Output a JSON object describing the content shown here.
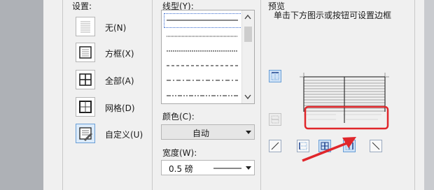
{
  "sections": {
    "settings_label": "设置:",
    "line_style_label": "线型(Y):",
    "preview_label": "预览",
    "preview_hint": "单击下方图示或按钮可设置边框",
    "color_label": "颜色(C):",
    "width_label": "宽度(W):"
  },
  "settings": [
    {
      "label": "无(N)",
      "icon": "no-border-icon"
    },
    {
      "label": "方框(X)",
      "icon": "box-border-icon"
    },
    {
      "label": "全部(A)",
      "icon": "all-borders-icon"
    },
    {
      "label": "网格(D)",
      "icon": "grid-border-icon"
    },
    {
      "label": "自定义(U)",
      "icon": "custom-border-icon",
      "selected": true
    }
  ],
  "line_styles": [
    "solid",
    "dotted",
    "dashed-fine",
    "dashed",
    "dash-dot",
    "dash-dot-dot"
  ],
  "color": {
    "value": "自动"
  },
  "width": {
    "value": "0.5 磅"
  },
  "annotation_color": "#e0262b",
  "selection_color": "#6a9fd6"
}
